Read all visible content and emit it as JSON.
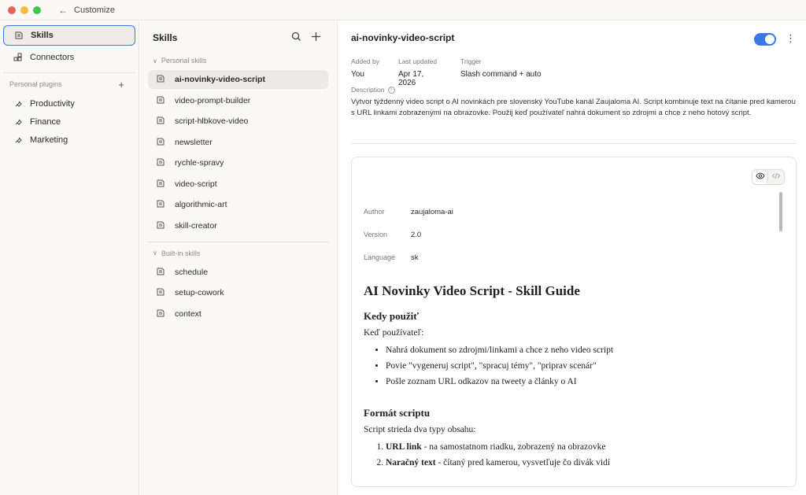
{
  "titlebar": {
    "crumb": "Customize"
  },
  "nav": {
    "items": [
      {
        "label": "Skills"
      },
      {
        "label": "Connectors"
      }
    ],
    "plugins_label": "Personal plugins",
    "plugins": [
      {
        "label": "Productivity"
      },
      {
        "label": "Finance"
      },
      {
        "label": "Marketing"
      }
    ]
  },
  "skills_panel": {
    "title": "Skills",
    "personal_label": "Personal skills",
    "personal": [
      "ai-novinky-video-script",
      "video-prompt-builder",
      "script-hlbkove-video",
      "newsletter",
      "rychle-spravy",
      "video-script",
      "algorithmic-art",
      "skill-creator"
    ],
    "builtin_label": "Built-in skills",
    "builtin": [
      "schedule",
      "setup-cowork",
      "context"
    ]
  },
  "detail": {
    "title": "ai-novinky-video-script",
    "enabled": true,
    "meta": [
      {
        "key": "Added by",
        "value": "You"
      },
      {
        "key": "Last updated",
        "value": "Apr 17, 2026"
      },
      {
        "key": "Trigger",
        "value": "Slash command + auto"
      }
    ],
    "description_label": "Description",
    "description": "Vytvor týždenný video script o AI novinkách pre slovenský YouTube kanál Zaujaloma AI. Script kombinuje text na čítanie pred kamerou s URL linkami zobrazenými na obrazovke. Použij keď používateľ nahrá dokument so zdrojmi a chce z neho hotový script.",
    "frontmatter": [
      {
        "key": "Author",
        "value": "zaujaloma-ai"
      },
      {
        "key": "Version",
        "value": "2.0"
      },
      {
        "key": "Language",
        "value": "sk"
      }
    ],
    "doc": {
      "h1": "AI Novinky Video Script - Skill Guide",
      "h2_when": "Kedy použiť",
      "when_intro": "Keď používateľ:",
      "when_items": [
        "Nahrá dokument so zdrojmi/linkami a chce z neho video script",
        "Povie \"vygeneruj script\", \"spracuj témy\", \"priprav scenár\"",
        "Pošle zoznam URL odkazov na tweety a články o AI"
      ],
      "h2_format": "Formát scriptu",
      "format_intro": "Script strieda dva typy obsahu:",
      "format_items": [
        {
          "bold": "URL link",
          "rest": " - na samostatnom riadku, zobrazený na obrazovke"
        },
        {
          "bold": "Naračný text",
          "rest": " - čítaný pred kamerou, vysvetľuje čo divák vidí"
        }
      ]
    }
  },
  "colors": {
    "accent": "#3b78e7",
    "panel_bg": "#faf9f7"
  }
}
